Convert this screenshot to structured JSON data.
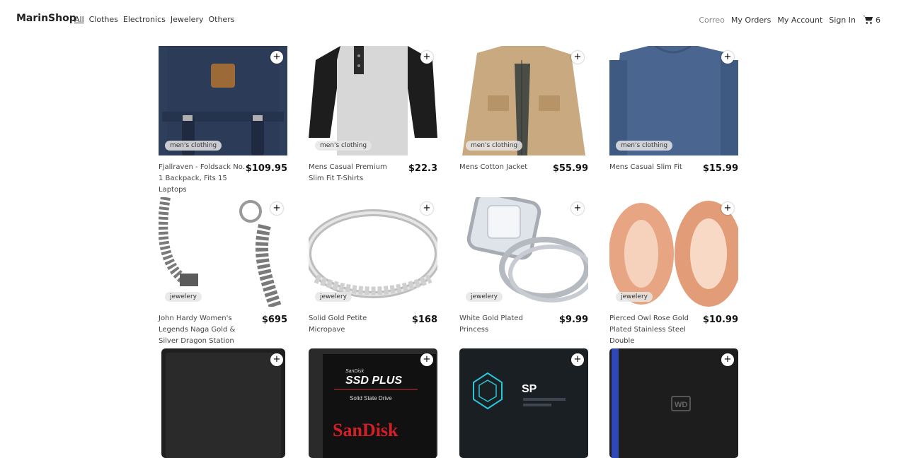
{
  "nav": {
    "brand": "MarinShop",
    "categories": [
      "All",
      "Clothes",
      "Electronics",
      "Jewelery",
      "Others"
    ],
    "right": {
      "email": "Correo",
      "orders": "My Orders",
      "account": "My Account",
      "signin": "Sign In",
      "cart_count": "6"
    }
  },
  "products": [
    {
      "title": "Fjallraven - Foldsack No. 1 Backpack, Fits 15 Laptops",
      "price": "$109.95",
      "category": "men's clothing"
    },
    {
      "title": "Mens Casual Premium Slim Fit T-Shirts",
      "price": "$22.3",
      "category": "men's clothing"
    },
    {
      "title": "Mens Cotton Jacket",
      "price": "$55.99",
      "category": "men's clothing"
    },
    {
      "title": "Mens Casual Slim Fit",
      "price": "$15.99",
      "category": "men's clothing"
    },
    {
      "title": "John Hardy Women's Legends Naga Gold & Silver Dragon Station Chain Bracelet",
      "price": "$695",
      "category": "jewelery"
    },
    {
      "title": "Solid Gold Petite Micropave",
      "price": "$168",
      "category": "jewelery"
    },
    {
      "title": "White Gold Plated Princess",
      "price": "$9.99",
      "category": "jewelery"
    },
    {
      "title": "Pierced Owl Rose Gold Plated Stainless Steel Double",
      "price": "$10.99",
      "category": "jewelery"
    },
    {
      "title": "",
      "price": "",
      "category": ""
    },
    {
      "title": "",
      "price": "",
      "category": ""
    },
    {
      "title": "",
      "price": "",
      "category": ""
    },
    {
      "title": "",
      "price": "",
      "category": ""
    }
  ],
  "image_text": {
    "sandisk_brand": "SanDisk",
    "sandisk_line": "SSD PLUS",
    "sandisk_sub": "Solid State Drive",
    "sp_logo": "SP",
    "wd_logo": "WD"
  },
  "colors": {
    "accent": "#000000",
    "tag_bg": "#e6e6e6"
  }
}
